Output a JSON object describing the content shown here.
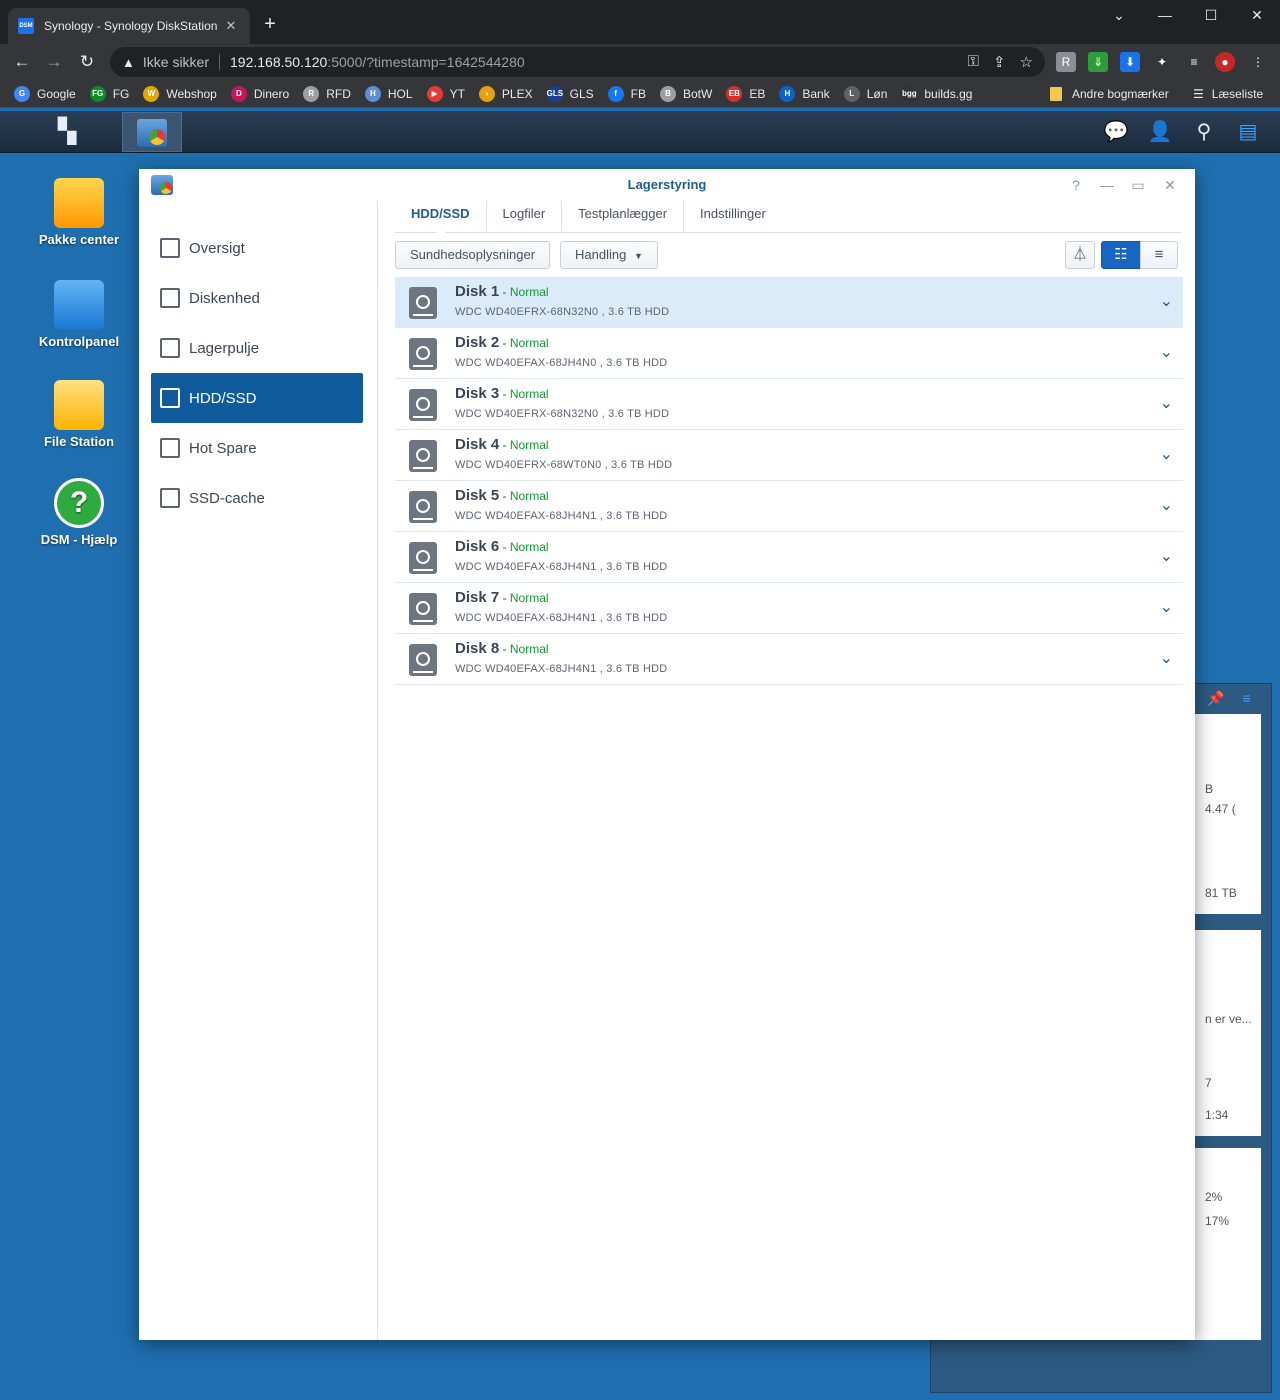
{
  "browser": {
    "tab_title": "Synology - Synology DiskStation",
    "tab_favicon": "DSM",
    "insecure_label": "Ikke sikker",
    "url_host": "192.168.50.120",
    "url_path": ":5000/?timestamp=1642544280",
    "bookmarks": [
      {
        "label": "Google",
        "icon": "G",
        "color": "#4285f4"
      },
      {
        "label": "FG",
        "icon": "FG",
        "color": "#0a8f2d"
      },
      {
        "label": "Webshop",
        "icon": "W",
        "color": "#e0a800"
      },
      {
        "label": "Dinero",
        "icon": "D",
        "color": "#c2185b"
      },
      {
        "label": "RFD",
        "icon": "R",
        "color": "#9e9e9e"
      },
      {
        "label": "HOL",
        "icon": "H",
        "color": "#5c8fd6"
      },
      {
        "label": "YT",
        "icon": "▶",
        "color": "#e53935"
      },
      {
        "label": "PLEX",
        "icon": "›",
        "color": "#e5a00d"
      },
      {
        "label": "GLS",
        "icon": "GLS",
        "color": "#1c3f94"
      },
      {
        "label": "FB",
        "icon": "f",
        "color": "#1877f2"
      },
      {
        "label": "BotW",
        "icon": "B",
        "color": "#9e9e9e"
      },
      {
        "label": "EB",
        "icon": "EB",
        "color": "#d32f2f"
      },
      {
        "label": "Bank",
        "icon": "H",
        "color": "#0b63c5"
      },
      {
        "label": "Løn",
        "icon": "L",
        "color": "#616161"
      },
      {
        "label": "builds.gg",
        "icon": "bgg",
        "color": "#333333"
      }
    ],
    "other_bookmarks": "Andre bogmærker",
    "reading_list": "Læseliste"
  },
  "desktop": {
    "icons": [
      {
        "label": "Pakke center"
      },
      {
        "label": "Kontrolpanel"
      },
      {
        "label": "File Station"
      },
      {
        "label": "DSM - Hjælp"
      }
    ],
    "widget_fragments": [
      "B",
      "4.47 (",
      "81 TB",
      "n er ve...",
      "7",
      "1:34",
      "2%",
      "17%"
    ]
  },
  "window": {
    "title": "Lagerstyring",
    "help_glyph": "?",
    "sidebar": [
      {
        "label": "Oversigt",
        "active": false
      },
      {
        "label": "Diskenhed",
        "active": false
      },
      {
        "label": "Lagerpulje",
        "active": false
      },
      {
        "label": "HDD/SSD",
        "active": true
      },
      {
        "label": "Hot Spare",
        "active": false
      },
      {
        "label": "SSD-cache",
        "active": false
      }
    ],
    "tabs": [
      {
        "label": "HDD/SSD",
        "active": true
      },
      {
        "label": "Logfiler",
        "active": false
      },
      {
        "label": "Testplanlægger",
        "active": false
      },
      {
        "label": "Indstillinger",
        "active": false
      }
    ],
    "toolbar": {
      "health_button": "Sundhedsoplysninger",
      "action_button": "Handling"
    },
    "disks": [
      {
        "name": "Disk 1",
        "status": "Normal",
        "model": "WDC WD40EFRX-68N32N0 , 3.6 TB HDD",
        "selected": true
      },
      {
        "name": "Disk 2",
        "status": "Normal",
        "model": "WDC WD40EFAX-68JH4N0 , 3.6 TB HDD",
        "selected": false
      },
      {
        "name": "Disk 3",
        "status": "Normal",
        "model": "WDC WD40EFRX-68N32N0 , 3.6 TB HDD",
        "selected": false
      },
      {
        "name": "Disk 4",
        "status": "Normal",
        "model": "WDC WD40EFRX-68WT0N0 , 3.6 TB HDD",
        "selected": false
      },
      {
        "name": "Disk 5",
        "status": "Normal",
        "model": "WDC WD40EFAX-68JH4N1 , 3.6 TB HDD",
        "selected": false
      },
      {
        "name": "Disk 6",
        "status": "Normal",
        "model": "WDC WD40EFAX-68JH4N1 , 3.6 TB HDD",
        "selected": false
      },
      {
        "name": "Disk 7",
        "status": "Normal",
        "model": "WDC WD40EFAX-68JH4N1 , 3.6 TB HDD",
        "selected": false
      },
      {
        "name": "Disk 8",
        "status": "Normal",
        "model": "WDC WD40EFAX-68JH4N1 , 3.6 TB HDD",
        "selected": false
      }
    ]
  },
  "colors": {
    "accent": "#0f5b9c",
    "status_normal": "#0d9b2e",
    "selected_row": "#dcebfa"
  }
}
